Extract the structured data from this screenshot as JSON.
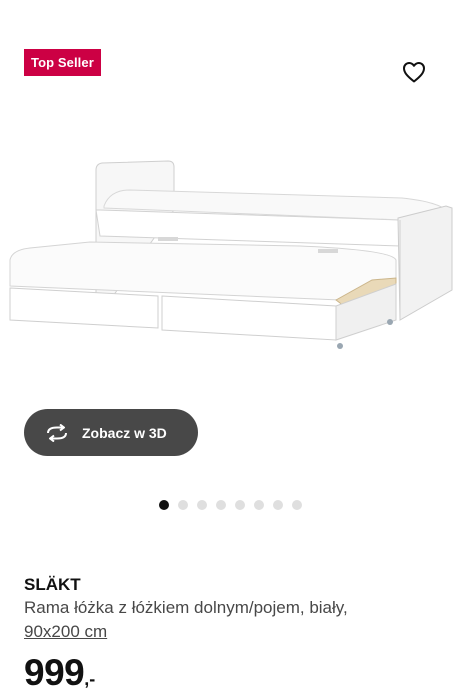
{
  "badge": {
    "label": "Top Seller",
    "color": "#cc0044"
  },
  "favorite": {
    "icon": "heart-outline-icon"
  },
  "image": {
    "alt_subject": "bed-frame-with-pull-out-bed"
  },
  "view3d": {
    "label": "Zobacz w 3D",
    "icon": "rotate-arrows-icon"
  },
  "carousel": {
    "total": 8,
    "active": 1
  },
  "product": {
    "name": "SLÄKT",
    "description": "Rama łóżka z łóżkiem dolnym/pojem, biały,",
    "size": "90x200 cm",
    "price_int": "999",
    "price_dec": ",-"
  }
}
